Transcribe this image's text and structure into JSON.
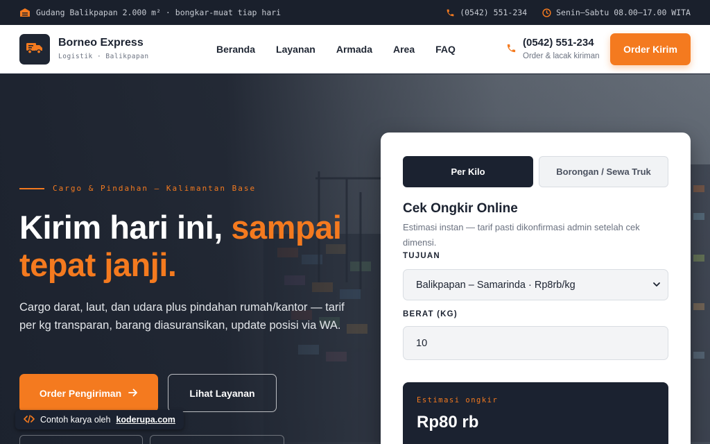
{
  "topbar": {
    "warehouse_text": "Gudang Balikpapan 2.000 m² · bongkar-muat tiap hari",
    "phone": "(0542) 551-234",
    "hours": "Senin–Sabtu 08.00–17.00 WITA"
  },
  "header": {
    "brand_name": "Borneo Express",
    "brand_sub": "Logistik · Balikpapan",
    "nav": [
      "Beranda",
      "Layanan",
      "Armada",
      "Area",
      "FAQ"
    ],
    "phone": "(0542) 551-234",
    "phone_sub": "Order & lacak kiriman",
    "cta": "Order Kirim"
  },
  "hero": {
    "eyebrow": "Cargo & Pindahan — Kalimantan Base",
    "headline_white": "Kirim hari ini,",
    "headline_accent_1": "sampai",
    "headline_accent_2": "tepat janji.",
    "lead": "Cargo darat, laut, dan udara plus pindahan rumah/kantor — tarif per kg transparan, barang diasuransikan, update posisi via WA.",
    "primary_button": "Order Pengiriman",
    "secondary_button": "Lihat Layanan"
  },
  "credit": {
    "prefix": "Contoh karya oleh",
    "link": "koderupa.com"
  },
  "quote": {
    "tabs": [
      "Per Kilo",
      "Borongan / Sewa Truk"
    ],
    "active_tab": "Per Kilo",
    "title": "Cek Ongkir Online",
    "subtitle": "Estimasi instan — tarif pasti dikonfirmasi admin setelah cek dimensi.",
    "destination_label": "TUJUAN",
    "destination_value": "Balikpapan – Samarinda · Rp8rb/kg",
    "weight_label": "BERAT (KG)",
    "weight_value": "10",
    "estimate_label": "Estimasi ongkir",
    "estimate_value": "Rp80 rb"
  },
  "colors": {
    "accent": "#f47a1f",
    "dark": "#1b2230"
  }
}
